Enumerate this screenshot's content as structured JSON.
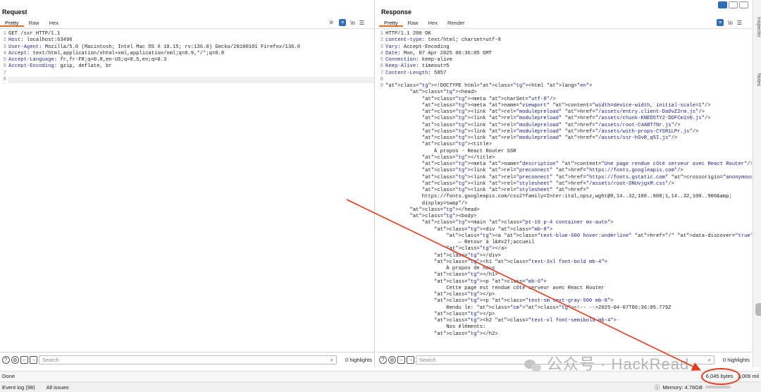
{
  "request": {
    "title": "Request",
    "tabs": [
      "Pretty",
      "Raw",
      "Hex"
    ],
    "newline_label": "\\n",
    "line_numbers": [
      "1",
      "2",
      "3",
      "4",
      "5",
      "6",
      "7",
      "8"
    ],
    "lines": [
      {
        "k": "",
        "v": "GET /ssr HTTP/1.1"
      },
      {
        "k": "Host",
        "v": ": localhost:63496"
      },
      {
        "k": "User-Agent",
        "v": ": Mozilla/5.0 (Macintosh; Intel Mac OS X 10.15; rv:136.0) Gecko/20100101 Firefox/136.0"
      },
      {
        "k": "Accept",
        "v": ": text/html,application/xhtml+xml,application/xml;q=0.9,*/*;q=0.8"
      },
      {
        "k": "Accept-Language",
        "v": ": fr,fr-FR;q=0.8,en-US;q=0.5,en;q=0.3"
      },
      {
        "k": "Accept-Encoding",
        "v": ": gzip, deflate, br"
      },
      {
        "k": "",
        "v": ""
      },
      {
        "k": "",
        "v": ""
      }
    ],
    "search_placeholder": "Search",
    "highlights": "0 highlights"
  },
  "response": {
    "title": "Response",
    "tabs": [
      "Pretty",
      "Raw",
      "Hex",
      "Render"
    ],
    "newline_label": "\\n",
    "line_numbers": [
      "1",
      "2",
      "3",
      "4",
      "5",
      "6",
      "7",
      "8",
      "9"
    ],
    "header_lines": [
      {
        "k": "",
        "v": "HTTP/1.1 200 OK"
      },
      {
        "k": "content-type",
        "v": ": text/html; charset=utf-8"
      },
      {
        "k": "Vary",
        "v": ": Accept-Encoding"
      },
      {
        "k": "Date",
        "v": ": Mon, 07 Apr 2025 06:36:05 GMT"
      },
      {
        "k": "Connection",
        "v": ": keep-alive"
      },
      {
        "k": "Keep-Alive",
        "v": ": timeout=5"
      },
      {
        "k": "Content-Length",
        "v": ": 5857"
      },
      {
        "k": "",
        "v": ""
      }
    ],
    "body_lines": [
      "<!DOCTYPE html><html lang=\"en\">",
      "        <head>",
      "            <meta charSet=\"utf-8\"/>",
      "            <meta name=\"viewport\" content=\"width=device-width, initial-scale=1\"/>",
      "            <link rel=\"modulepreload\" href=\"/assets/entry.client-DaOvZ2rm.js\"/>",
      "            <link rel=\"modulepreload\" href=\"/assets/chunk-KNED5TY2-DDFCm1n0.js\"/>",
      "            <link rel=\"modulepreload\" href=\"/assets/root-C4ABT7Nr.js\"/>",
      "            <link rel=\"modulepreload\" href=\"/assets/with-props-CYSR1LPr.js\"/>",
      "            <link rel=\"modulepreload\" href=\"/assets/ssr-hGvR_q5I.js\"/>",
      "            <title>",
      "                À propos - React Router SSR",
      "            </title>",
      "            <meta name=\"description\" content=\"Une page rendue côté serveur avec React Router\"/>",
      "            <link rel=\"preconnect\" href=\"https://fonts.googleapis.com\"/>",
      "            <link rel=\"preconnect\" href=\"https://fonts.gstatic.com\" crossorigin=\"anonymous\"/>",
      "            <link rel=\"stylesheet\" href=\"/assets/root-DNUvjgxM.css\"/>",
      "            <link rel=\"stylesheet\" href=\"",
      "            https://fonts.googleapis.com/css2?family=Inter:ital,opsz,wght@0,14..32,100..900;1,14..32,100..900&amp;",
      "            display=swap\"/>",
      "        </head>",
      "        <body>",
      "            <main class=\"pt-16 p-4 container mx-auto\">",
      "                <div class=\"mb-8\">",
      "                    <a class=\"text-blue-600 hover:underline\" href=\"/\" data-discover=\"true\">",
      "                        ← Retour à l&#x27;accueil",
      "                    </a>",
      "                </div>",
      "                <h1 class=\"text-3xl font-bold mb-4\">",
      "                    À propos de nous",
      "                </h1>",
      "                <p class=\"mb-6\">",
      "                    Cette page est rendue côté serveur avec React Router",
      "                </p>",
      "                <p class=\"text-sm text-gray-500 mb-8\">",
      "                    Rendu le: <!-- -->2025-04-07T06:36:05.779Z",
      "                </p>",
      "                <h2 class=\"text-xl font-semibold mb-4\">",
      "                    Nos éléments:",
      "                </h2>"
    ],
    "search_placeholder": "Search",
    "highlights": "0 highlights"
  },
  "sidebar_labels": [
    "Inspector",
    "Notes"
  ],
  "status": {
    "left": "Done",
    "bytes": "6,045 bytes",
    "millis": "1,009 mil"
  },
  "footer": {
    "event_log": "Event log (98)",
    "issues": "All issues",
    "memory": "Memory: 4.76GB"
  },
  "watermark": "公众号 · HackRead",
  "colors": {
    "accent_tab": "#e56c1f",
    "annotation": "#e53a1c",
    "toggle_blue": "#2f6fb5"
  }
}
